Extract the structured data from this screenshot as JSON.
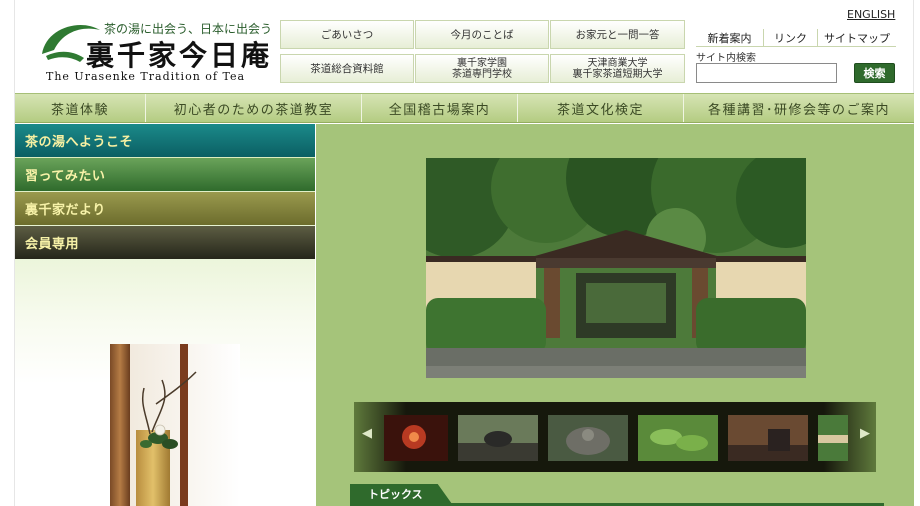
{
  "logo": {
    "tagline": "茶の湯に出会う、日本に出会う",
    "name": "裏千家今日庵",
    "english": "The Urasenke Tradition of Tea"
  },
  "top_nav": {
    "row1": [
      "ごあいさつ",
      "今月のことば",
      "お家元と一問一答"
    ],
    "row2": [
      "茶道総合資料館",
      "裏千家学園\n茶道専門学校",
      "天津商業大学\n裏千家茶道短期大学"
    ]
  },
  "utility": {
    "english": "ENGLISH",
    "links": [
      "新着案内",
      "リンク",
      "サイトマップ"
    ],
    "search_label": "サイト内検索",
    "search_value": "",
    "search_button": "検索"
  },
  "main_nav": [
    "茶道体験",
    "初心者のための茶道教室",
    "全国稽古場案内",
    "茶道文化検定",
    "各種講習･研修会等のご案内"
  ],
  "side_menu": [
    "茶の湯へようこそ",
    "習ってみたい",
    "裏千家だより",
    "会員専用"
  ],
  "carousel": {
    "prev": "◀",
    "next": "▶",
    "thumbs": [
      "red-flower-thumbnail",
      "tea-bowl-thumbnail",
      "stone-lantern-thumbnail",
      "tea-leaves-thumbnail",
      "tea-ceremony-thumbnail",
      "garden-thumbnail"
    ]
  },
  "topics": {
    "label": "トピックス"
  },
  "colors": {
    "brand_green": "#2f6a2c",
    "content_bg": "#a5c47a",
    "nav_green": "#c3d69a"
  }
}
